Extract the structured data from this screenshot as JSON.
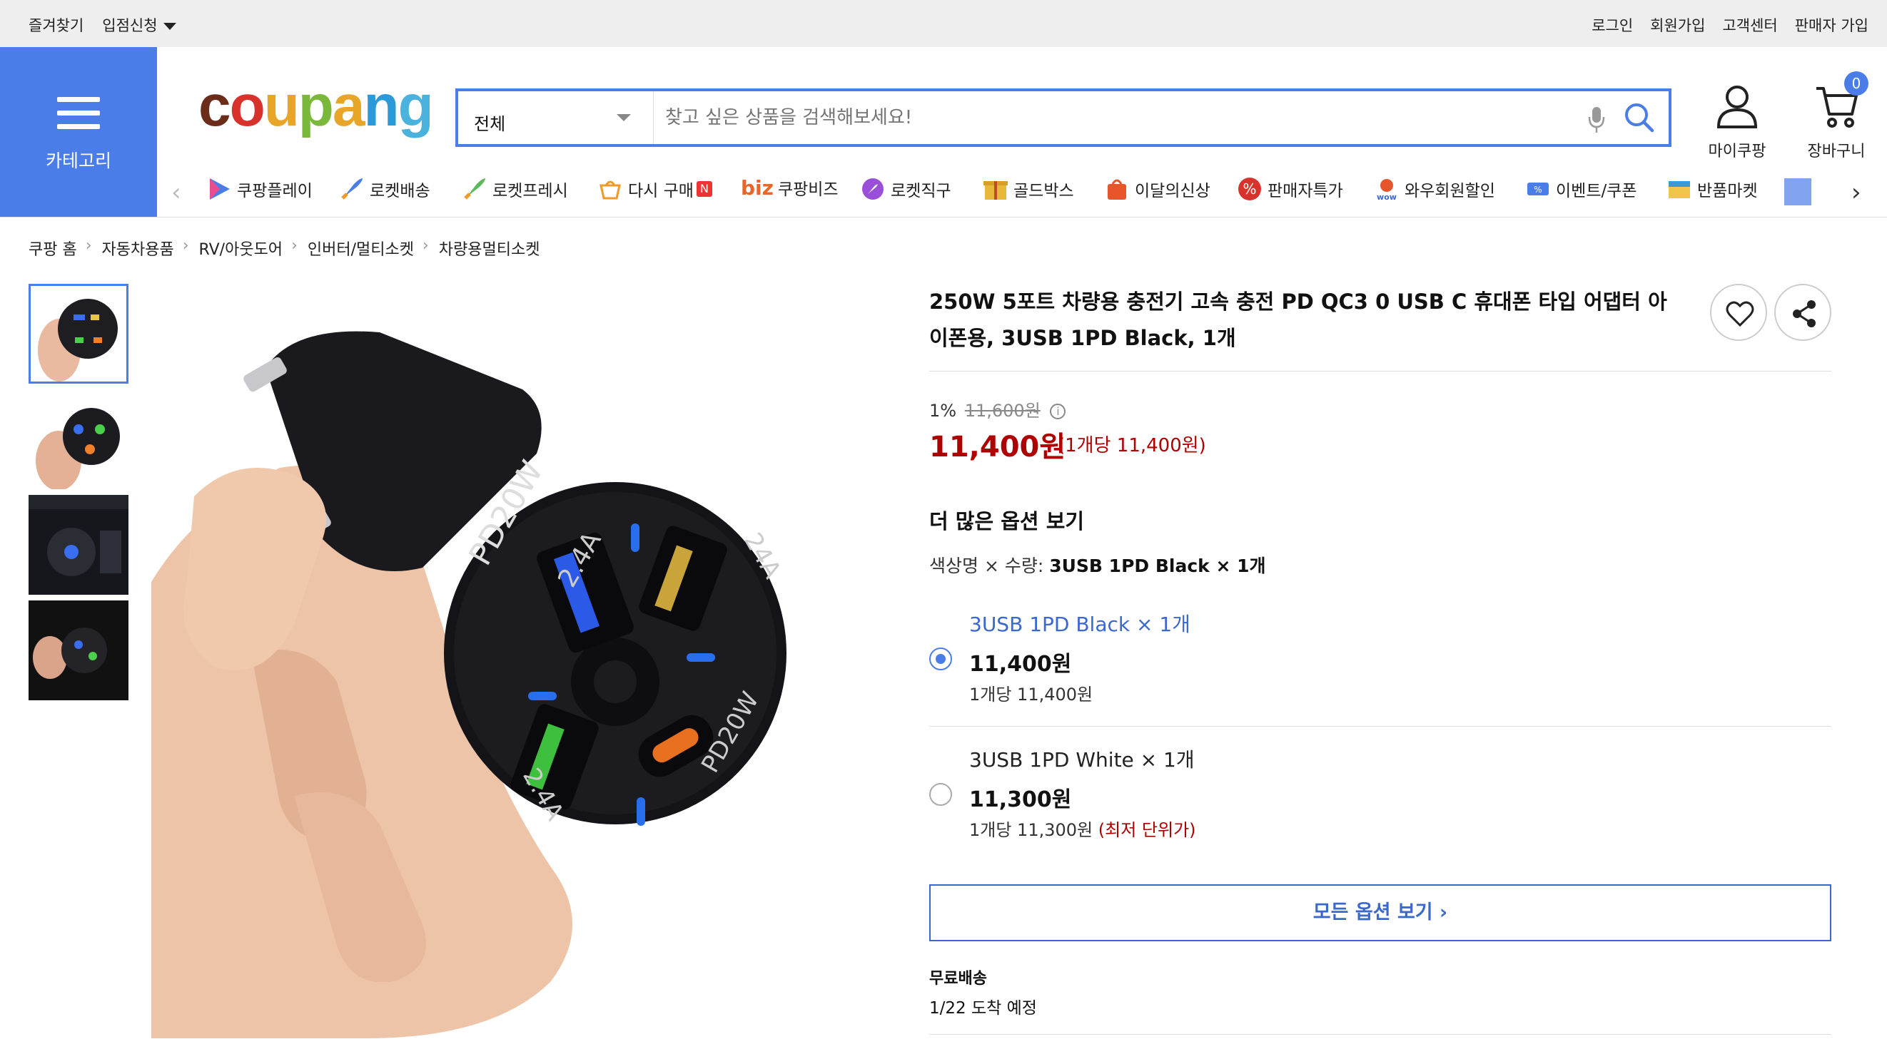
{
  "topbar": {
    "bookmark": "즐겨찾기",
    "seller_apply": "입점신청",
    "login": "로그인",
    "signup": "회원가입",
    "support": "고객센터",
    "seller_join": "판매자 가입"
  },
  "category": {
    "label": "카테고리"
  },
  "logo": {
    "text": "coupang"
  },
  "search": {
    "scope": "전체",
    "placeholder": "찾고 싶은 상품을 검색해보세요!"
  },
  "header": {
    "mycoupang": "마이쿠팡",
    "cart": "장바구니",
    "cart_count": "0"
  },
  "nav": {
    "items": [
      {
        "label": "쿠팡플레이",
        "icon": "play-icon"
      },
      {
        "label": "로켓배송",
        "icon": "rocket-icon"
      },
      {
        "label": "로켓프레시",
        "icon": "rocket-fresh-icon"
      },
      {
        "label": "다시 구매",
        "icon": "rebuy-icon",
        "badge": "N"
      },
      {
        "label": "쿠팡비즈",
        "icon": "biz-icon",
        "prefix": "biz"
      },
      {
        "label": "로켓직구",
        "icon": "global-rocket-icon"
      },
      {
        "label": "골드박스",
        "icon": "goldbox-icon"
      },
      {
        "label": "이달의신상",
        "icon": "new-bag-icon"
      },
      {
        "label": "판매자특가",
        "icon": "percent-icon"
      },
      {
        "label": "와우회원할인",
        "icon": "wow-icon"
      },
      {
        "label": "이벤트/쿠폰",
        "icon": "coupon-icon"
      },
      {
        "label": "반품마켓",
        "icon": "return-market-icon"
      }
    ]
  },
  "breadcrumb": [
    "쿠팡 홈",
    "자동차용품",
    "RV/아웃도어",
    "인버터/멀티소켓",
    "차량용멀티소켓"
  ],
  "product": {
    "title": "250W 5포트 차량용 충전기 고속 충전 PD QC3 0 USB C 휴대폰 타입 어댑터 아이폰용, 3USB 1PD Black, 1개",
    "discount_rate": "1%",
    "original_price": "11,600원",
    "price": "11,400원",
    "unit_price": "(1개당 11,400원)",
    "more_options": "더 많은 옵션 보기",
    "chosen_label": "색상명 × 수량:",
    "chosen_value": "3USB 1PD Black × 1개",
    "options": [
      {
        "name": "3USB 1PD Black × 1개",
        "price": "11,400원",
        "unit": "1개당 11,400원",
        "note": "",
        "selected": true
      },
      {
        "name": "3USB 1PD White × 1개",
        "price": "11,300원",
        "unit": "1개당 11,300원",
        "note": "(최저 단위가)",
        "selected": false
      }
    ],
    "all_options": "모든 옵션 보기",
    "shipping": "무료배송",
    "arrival": "1/22 도착 예정"
  },
  "colors": {
    "brand_blue": "#4a7de8",
    "price_red": "#ae0000"
  }
}
